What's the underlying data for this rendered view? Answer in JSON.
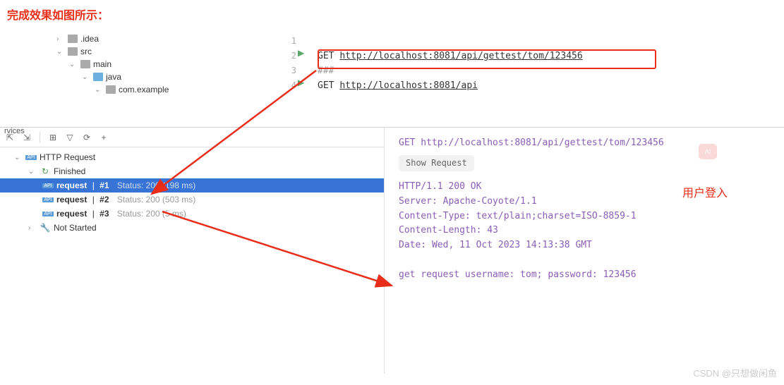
{
  "caption": "完成效果如图所示：",
  "project_tree": {
    "idea": ".idea",
    "src": "src",
    "main": "main",
    "java": "java",
    "pkg": "com.example"
  },
  "editor": {
    "line_numbers": [
      "1",
      "2",
      "3",
      "4"
    ],
    "get_kw": "GET",
    "url1": "http://localhost:8081/api/gettest/tom/123456",
    "sep": "###",
    "url2": "http://localhost:8081/api"
  },
  "services_label": "rvices",
  "toolbar": {
    "expand": "⇱",
    "collapse": "⇲",
    "grid": "⊞",
    "filter": "▽",
    "refresh": "⟳",
    "add": "+"
  },
  "tree": {
    "root": "HTTP Request",
    "finished": "Finished",
    "finished_icon": "↻",
    "request_label": "request",
    "items": [
      {
        "num": "#1",
        "status": "Status: 200 (198 ms)"
      },
      {
        "num": "#2",
        "status": "Status: 200 (503 ms)"
      },
      {
        "num": "#3",
        "status": "Status: 200 (5 ms)"
      }
    ],
    "not_started": "Not Started"
  },
  "response": {
    "req_line": "GET http://localhost:8081/api/gettest/tom/123456",
    "show_req": "Show Request",
    "status": "HTTP/1.1 200 OK",
    "server": "Server: Apache-Coyote/1.1",
    "ctype": "Content-Type: text/plain;charset=ISO-8859-1",
    "clen": "Content-Length: 43",
    "date": "Date: Wed, 11 Oct 2023 14:13:38 GMT",
    "body": "get request username: tom; password: 123456"
  },
  "user_login": "用户登入",
  "ai_badge": "AI",
  "watermark": "CSDN @只想做闲鱼"
}
